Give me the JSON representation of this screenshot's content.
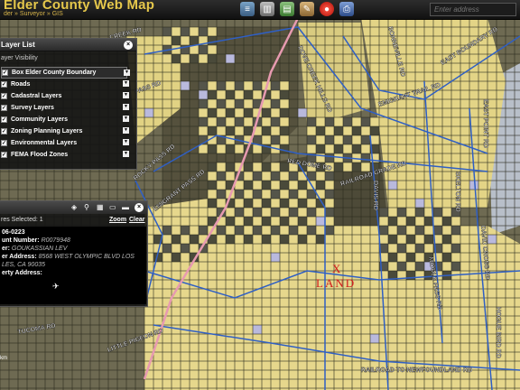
{
  "app": {
    "title": "Elder County Web Map",
    "breadcrumb": "der » Surveyor » GIS",
    "search_placeholder": "Enter address"
  },
  "toolbar": {
    "icons": [
      "layers-icon",
      "base-map-icon",
      "documents-icon",
      "tools-icon",
      "record-icon",
      "print-icon"
    ]
  },
  "layer_list": {
    "title": "Layer List",
    "visibility_label": "ayer Visibility",
    "layers": [
      {
        "label": "Box Elder County Boundary",
        "checked": true
      },
      {
        "label": "Roads",
        "checked": true
      },
      {
        "label": "Cadastral Layers",
        "checked": true
      },
      {
        "label": "Survey Layers",
        "checked": true
      },
      {
        "label": "Community Layers",
        "checked": true
      },
      {
        "label": "Zoning Planning Layers",
        "checked": true
      },
      {
        "label": "Environmental Layers",
        "checked": true
      },
      {
        "label": "FEMA Flood Zones",
        "checked": true
      }
    ]
  },
  "parcel_panel": {
    "selected_label": "res Selected: 1",
    "zoom": "Zoom",
    "clear": "Clear",
    "parcel_id": "06-0223",
    "account_label": "unt Number:",
    "account_value": "R0079948",
    "owner_label": "er:",
    "owner_value": "GOUKASSIAN LEV",
    "owner_addr_label": "er Address:",
    "owner_addr_value": "8568 WEST OLYMPIC BLVD LOS",
    "owner_addr_value2": "LES, CA 90035",
    "property_label": "erty Address:"
  },
  "map_labels": {
    "land_x": "X",
    "land": "LAND",
    "roads": [
      "CREEK RD",
      "PASS RD",
      "ROCKY PASS RD",
      "EMIGRANT PASS RD",
      "DOVE CREEK HILLS RD",
      "RED DOME RD",
      "RAILROAD GRADE RD",
      "MIDDLE PASS RD",
      "BONNEVILLE RD",
      "EMIGRANT TRAIL RD",
      "EAST BOUNDARY RD",
      "EAST POINT RD",
      "DAVID CROSS RD",
      "TUCOMA RD",
      "LITTLE PIGEON RD",
      "RAILROAD TO NEWFOUNDLAND RD",
      "HOGUE BIRD RD",
      "SKELTON RD",
      "DAVIS RD"
    ]
  },
  "scale": {
    "label": "km"
  },
  "colors": {
    "title": "#e6c84b",
    "parcel_fill": "#e6d78c",
    "parcel_grid": "#1f1f1f",
    "roads": "#2f5fc4",
    "highway": "#e79ab0",
    "land_marker": "#d11a1a"
  }
}
